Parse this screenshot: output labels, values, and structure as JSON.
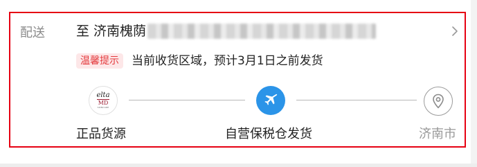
{
  "delivery": {
    "label": "配送",
    "address_prefix": "至 济南槐荫",
    "address_redacted": true,
    "chevron_icon": "chevron-right-icon"
  },
  "tip": {
    "badge": "温馨提示",
    "text": "当前收货区域，预计3月1日之前发货"
  },
  "steps": [
    {
      "label": "正品货源",
      "icon": "brand-logo-icon",
      "logo_line1": "elta",
      "logo_line2": "MD",
      "logo_line3": "SKINCARE"
    },
    {
      "label": "自营保税仓发货",
      "icon": "airplane-icon",
      "active": true
    },
    {
      "label": "济南市",
      "icon": "location-pin-icon"
    }
  ],
  "colors": {
    "accent_red": "#e4393c",
    "frame_red": "#e60012",
    "badge_bg": "#fde7e8",
    "active_blue": "#2b94e8",
    "muted_gray": "#999999"
  }
}
